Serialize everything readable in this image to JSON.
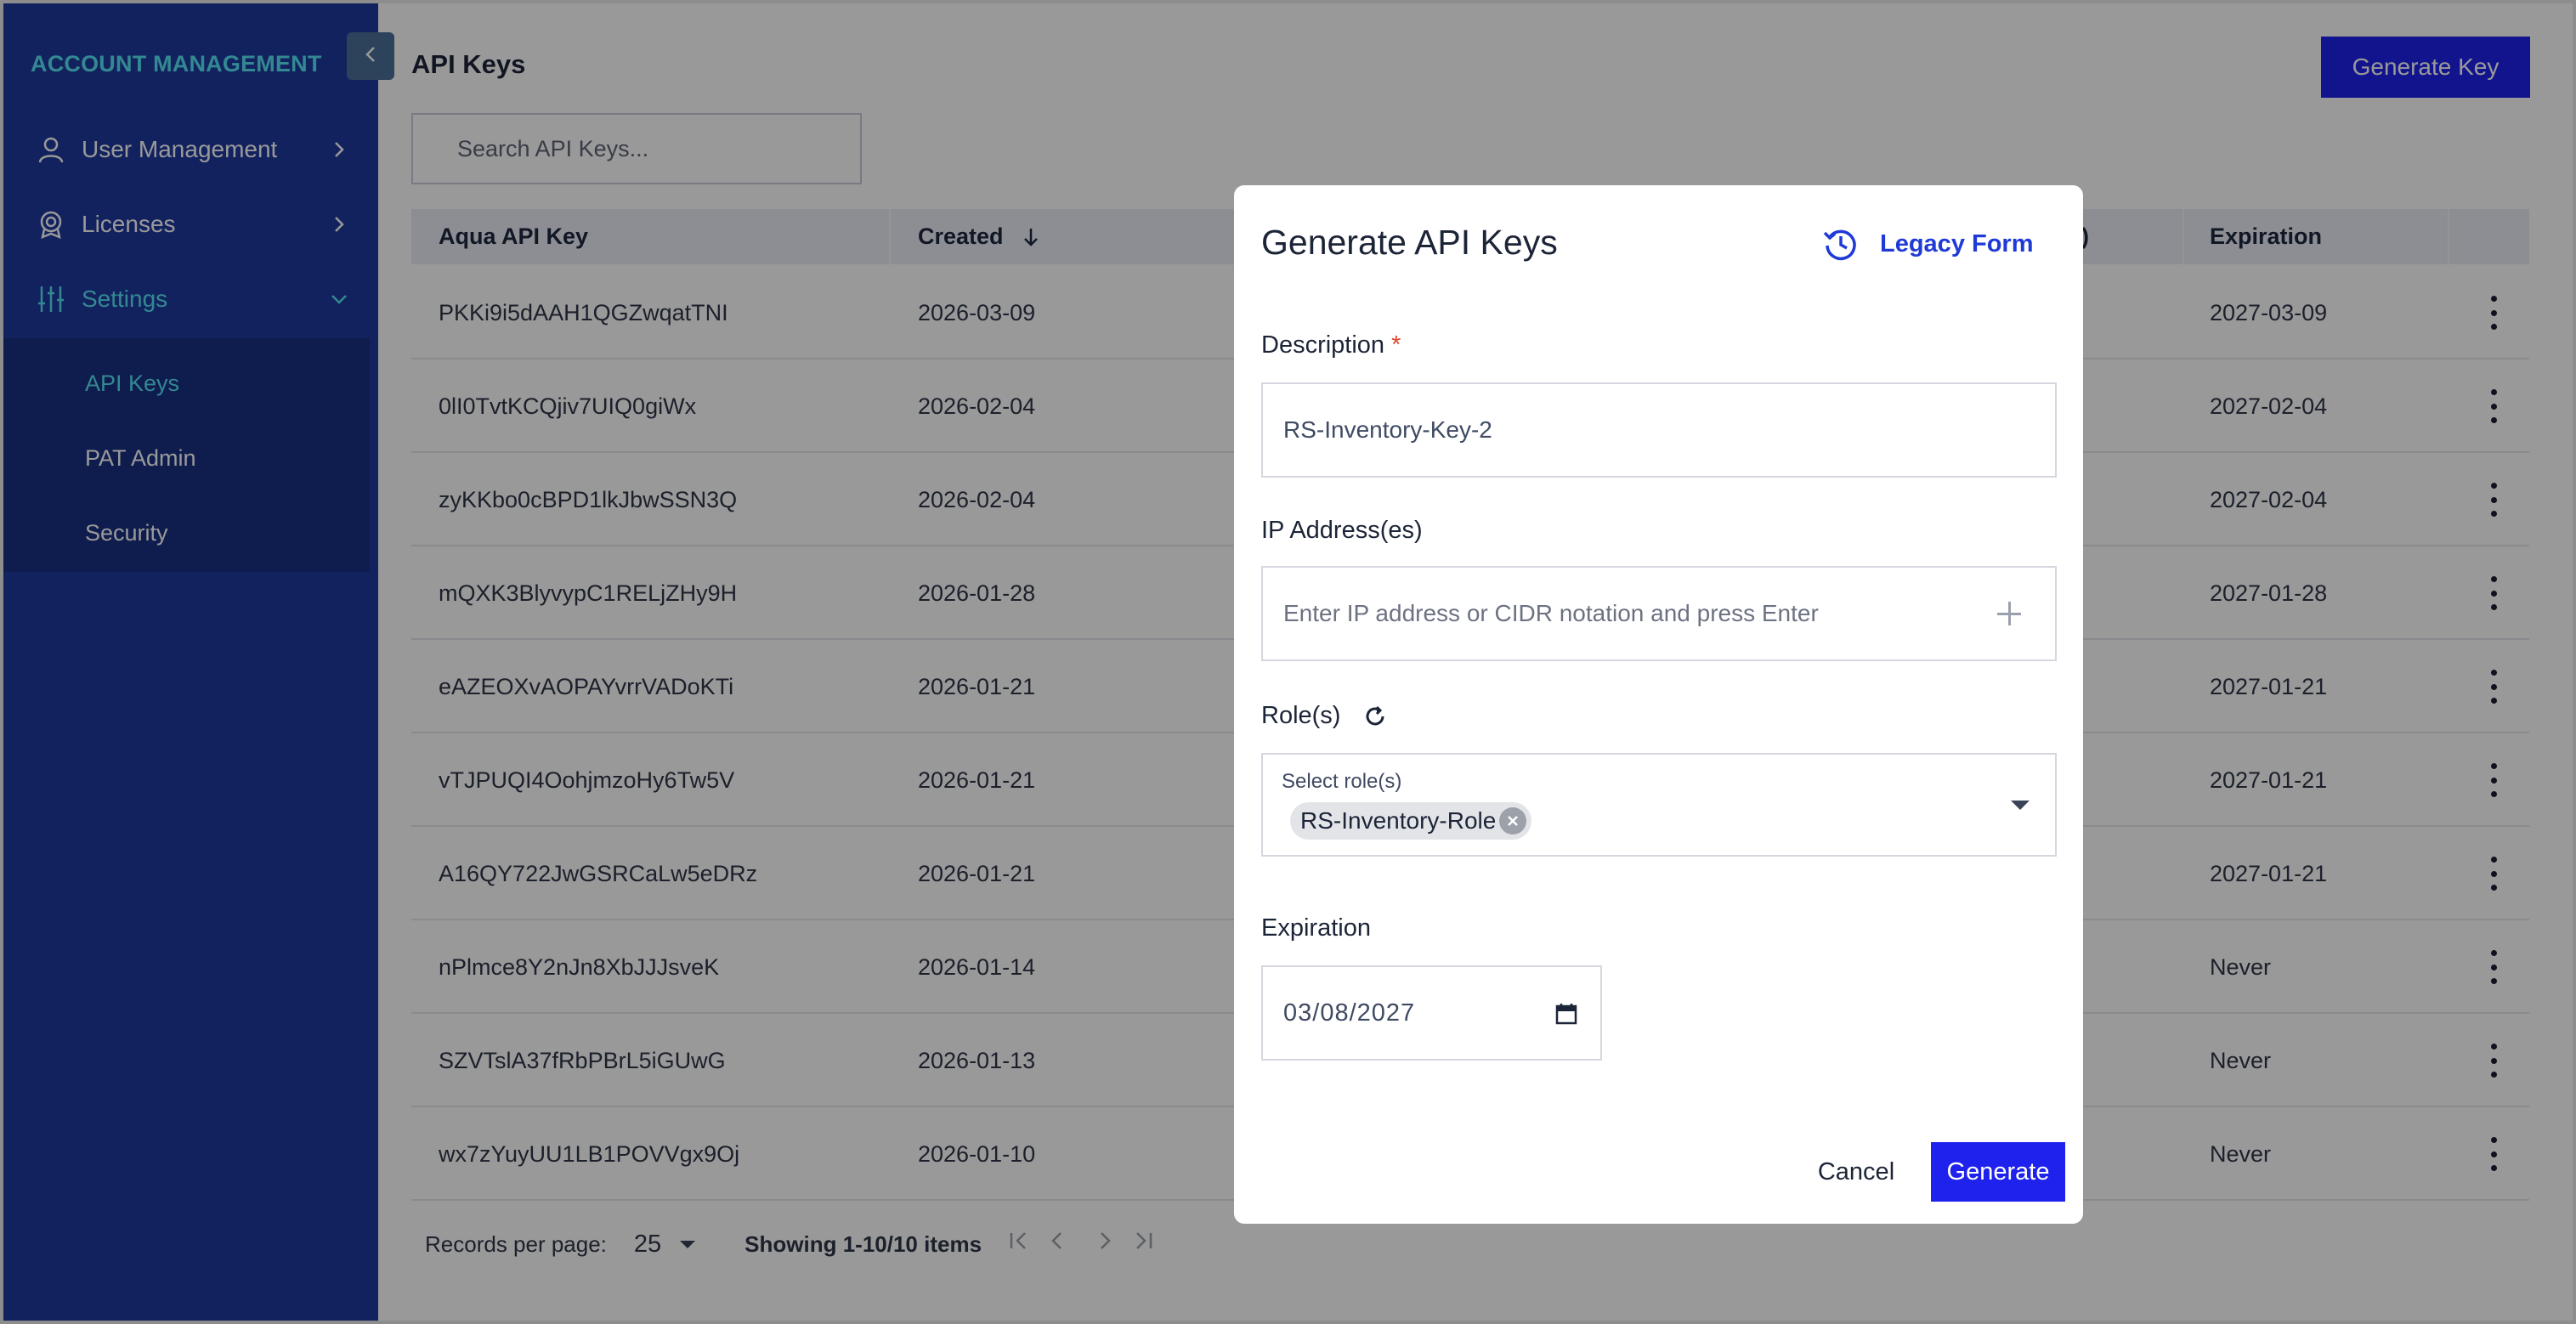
{
  "sidebar": {
    "title": "ACCOUNT MANAGEMENT",
    "items": [
      {
        "label": "User Management",
        "icon": "user-icon"
      },
      {
        "label": "Licenses",
        "icon": "badge-icon"
      },
      {
        "label": "Settings",
        "icon": "sliders-icon"
      }
    ],
    "submenu": [
      "API Keys",
      "PAT Admin",
      "Security"
    ]
  },
  "header": {
    "title": "API Keys",
    "generate_key_label": "Generate Key"
  },
  "search": {
    "placeholder": "Search API Keys..."
  },
  "table": {
    "columns": [
      "Aqua API Key",
      "Created",
      "s)",
      "Expiration"
    ],
    "rows": [
      {
        "key": "PKKi9i5dAAH1QGZwqatTNI",
        "created": "2026-03-09",
        "expiration": "2027-03-09"
      },
      {
        "key": "0lI0TvtKCQjiv7UIQ0giWx",
        "created": "2026-02-04",
        "expiration": "2027-02-04"
      },
      {
        "key": "zyKKbo0cBPD1lkJbwSSN3Q",
        "created": "2026-02-04",
        "expiration": "2027-02-04"
      },
      {
        "key": "mQXK3BlyvypC1RELjZHy9H",
        "created": "2026-01-28",
        "expiration": "2027-01-28"
      },
      {
        "key": "eAZEOXvAOPAYvrrVADoKTi",
        "created": "2026-01-21",
        "expiration": "2027-01-21"
      },
      {
        "key": "vTJPUQI4OohjmzoHy6Tw5V",
        "created": "2026-01-21",
        "expiration": "2027-01-21"
      },
      {
        "key": "A16QY722JwGSRCaLw5eDRz",
        "created": "2026-01-21",
        "expiration": "2027-01-21"
      },
      {
        "key": "nPlmce8Y2nJn8XbJJJsveK",
        "created": "2026-01-14",
        "expiration": "Never"
      },
      {
        "key": "SZVTslA37fRbPBrL5iGUwG",
        "created": "2026-01-13",
        "expiration": "Never"
      },
      {
        "key": "wx7zYuyUU1LB1POVVgx9Oj",
        "created": "2026-01-10",
        "expiration": "Never"
      }
    ]
  },
  "footer": {
    "records_label": "Records per page:",
    "per_page": "25",
    "showing": "Showing 1-10/10 items"
  },
  "modal": {
    "title": "Generate API Keys",
    "legacy_label": "Legacy Form",
    "description_label": "Description",
    "required_mark": "*",
    "description_value": "RS-Inventory-Key-2",
    "ip_label": "IP Address(es)",
    "ip_placeholder": "Enter IP address or CIDR notation and press Enter",
    "roles_label": "Role(s)",
    "roles_placeholder": "Select role(s)",
    "selected_role": "RS-Inventory-Role",
    "expiration_label": "Expiration",
    "expiration_value": "03/08/2027",
    "cancel_label": "Cancel",
    "generate_label": "Generate"
  },
  "colors": {
    "sidebar": "#1f3a9e",
    "accent": "#56e3f2",
    "primary_button": "#1e22ec"
  }
}
